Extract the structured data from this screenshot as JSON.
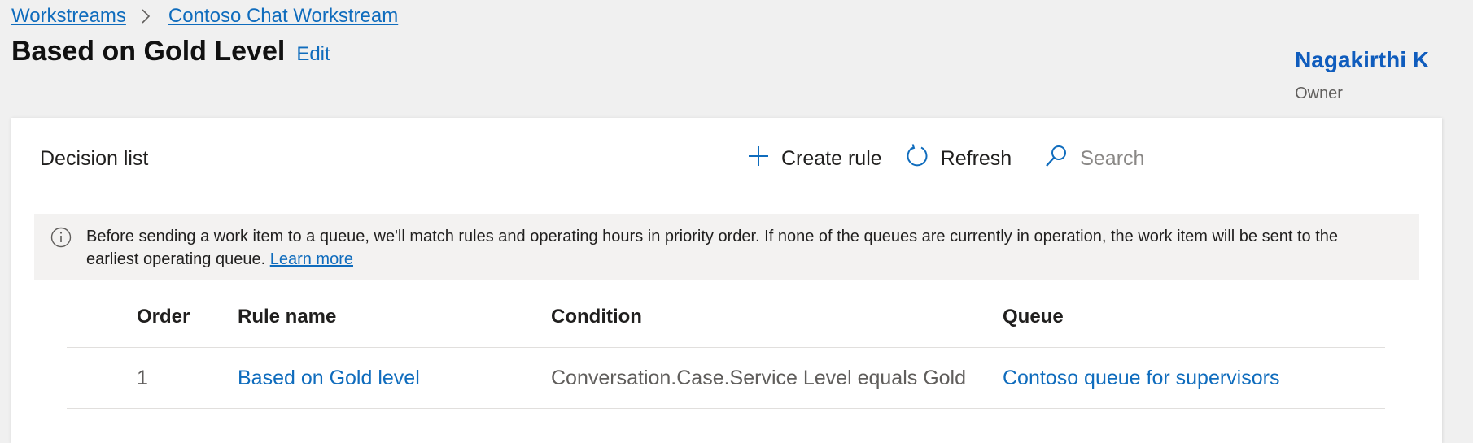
{
  "breadcrumb": {
    "items": [
      {
        "label": "Workstreams"
      },
      {
        "label": "Contoso Chat Workstream"
      }
    ]
  },
  "header": {
    "title": "Based on Gold Level",
    "edit_label": "Edit",
    "owner_name": "Nagakirthi K",
    "owner_role": "Owner"
  },
  "card": {
    "title": "Decision list",
    "toolbar": {
      "create_label": "Create rule",
      "refresh_label": "Refresh",
      "search_placeholder": "Search"
    },
    "info": {
      "text": "Before sending a work item to a queue, we'll match rules and operating hours in priority order. If none of the queues are currently in operation, the work item will be sent to the earliest operating queue.",
      "link_label": "Learn more"
    },
    "table": {
      "columns": [
        "Order",
        "Rule name",
        "Condition",
        "Queue"
      ],
      "rows": [
        {
          "order": "1",
          "rule_name": "Based on Gold level",
          "condition": "Conversation.Case.Service Level equals Gold",
          "queue": "Contoso queue for supervisors"
        }
      ]
    }
  },
  "colors": {
    "link": "#0f6cbd",
    "background": "#f0f0f0",
    "card": "#ffffff",
    "info_bar": "#f3f2f1"
  }
}
